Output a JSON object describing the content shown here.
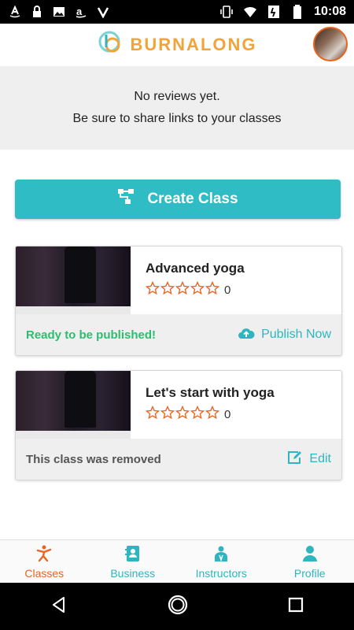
{
  "status_bar": {
    "time": "10:08",
    "left_icons": [
      "amazon-icon",
      "lock-icon",
      "image-icon",
      "amazon-icon",
      "check-icon"
    ],
    "right_icons": [
      "vibrate-icon",
      "wifi-icon",
      "signal-icon",
      "battery-icon"
    ]
  },
  "header": {
    "brand_name": "BURNALONG",
    "brand_color": "#f2a33a",
    "avatar_icon": "avatar"
  },
  "empty_state": {
    "line1": "No reviews yet.",
    "line2": "Be sure to share links to your classes"
  },
  "create_button": {
    "label": "Create Class",
    "icon": "sitemap-icon",
    "color": "#2fbcc4"
  },
  "classes": [
    {
      "title": "Advanced yoga",
      "rating": 0,
      "rating_count": "0",
      "status": "Ready to be published!",
      "status_color": "#2dbd6e",
      "action_label": "Publish Now",
      "action_icon": "cloud-upload-icon"
    },
    {
      "title": "Let's start with yoga",
      "rating": 0,
      "rating_count": "0",
      "status": "This class was removed",
      "status_color": "#555555",
      "action_label": "Edit",
      "action_icon": "edit-icon"
    }
  ],
  "tabs": [
    {
      "label": "Classes",
      "icon": "person-running-icon",
      "active": true
    },
    {
      "label": "Business",
      "icon": "address-book-icon",
      "active": false
    },
    {
      "label": "Instructors",
      "icon": "instructor-icon",
      "active": false
    },
    {
      "label": "Profile",
      "icon": "user-icon",
      "active": false
    }
  ],
  "accent_active": "#e8641f",
  "accent_inactive": "#2fb5bf",
  "nav_icons": [
    "back-icon",
    "home-icon",
    "recents-icon"
  ]
}
